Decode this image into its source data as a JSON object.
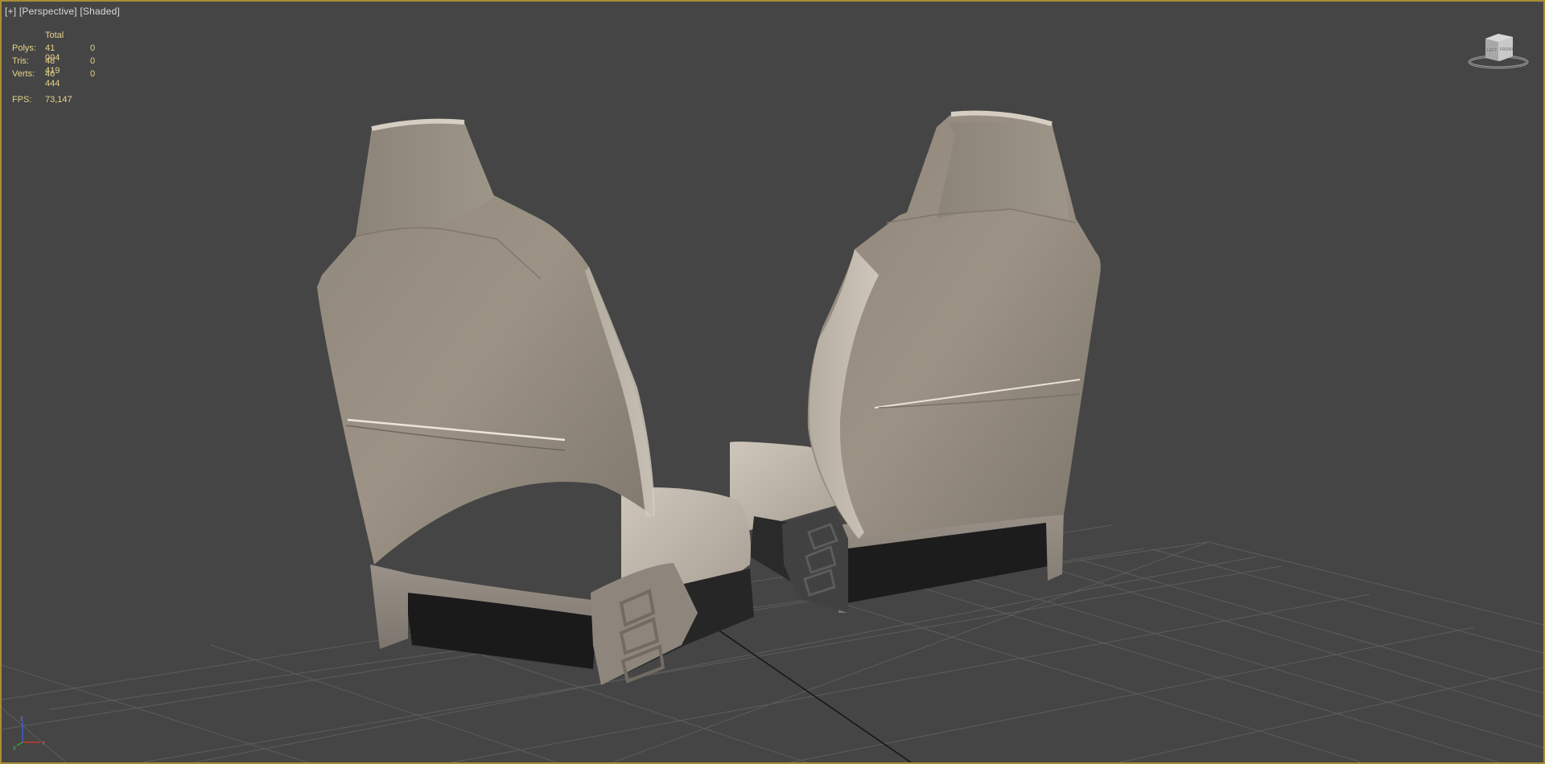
{
  "viewport": {
    "label": {
      "plus": "[+]",
      "view": "[Perspective]",
      "shading": "[Shaded]"
    },
    "stats": {
      "header": "Total",
      "rows": [
        {
          "label": "Polys:",
          "total": "41 004",
          "selected": "0"
        },
        {
          "label": "Tris:",
          "total": "48 419",
          "selected": "0"
        },
        {
          "label": "Verts:",
          "total": "46 444",
          "selected": "0"
        }
      ],
      "fps_label": "FPS:",
      "fps_value": "73,147"
    },
    "viewcube": {
      "left_face": "LEFT",
      "front_face": "FRONT"
    },
    "axis": {
      "z": "z",
      "x": "x",
      "y": "y"
    }
  },
  "colors": {
    "background": "#454545",
    "border": "#a88d34",
    "grid": "#5c5c5c",
    "grid_axis": "#111111",
    "stats_text": "#e6d28a",
    "seat_fabric": "#a49a8d"
  }
}
